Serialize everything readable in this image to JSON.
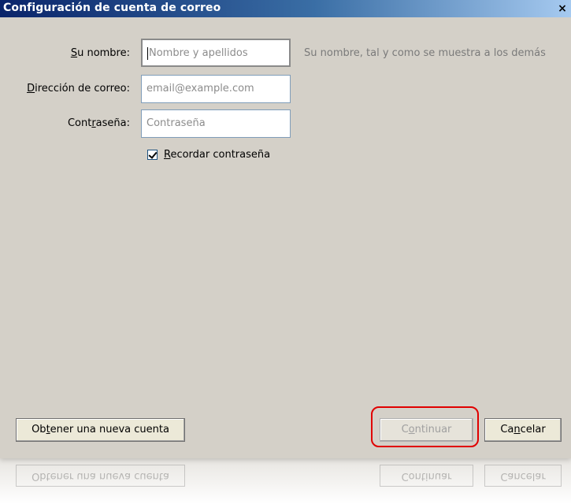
{
  "window": {
    "title": "Configuración de cuenta de correo",
    "close_glyph": "×"
  },
  "form": {
    "name": {
      "label_pre": "",
      "label_mnemonic": "S",
      "label_post": "u nombre:",
      "placeholder": "Nombre y apellidos",
      "hint": "Su nombre, tal y como se muestra a los demás"
    },
    "email": {
      "label_pre": "",
      "label_mnemonic": "D",
      "label_post": "irección de correo:",
      "placeholder": "email@example.com"
    },
    "password": {
      "label_pre": "Cont",
      "label_mnemonic": "r",
      "label_post": "aseña:",
      "placeholder": "Contraseña"
    },
    "remember": {
      "checked": true,
      "label_pre": "",
      "label_mnemonic": "R",
      "label_post": "ecordar contraseña"
    }
  },
  "buttons": {
    "new_account": {
      "pre": "Ob",
      "mnemonic": "t",
      "post": "ener una nueva cuenta"
    },
    "continue": {
      "pre": "C",
      "mnemonic": "o",
      "post": "ntinuar"
    },
    "cancel": {
      "pre": "Ca",
      "mnemonic": "n",
      "post": "celar"
    }
  },
  "colors": {
    "dialog_bg": "#d4d0c8",
    "titlebar_start": "#0a246a",
    "titlebar_end": "#a6caf0",
    "highlight": "#e00000"
  }
}
